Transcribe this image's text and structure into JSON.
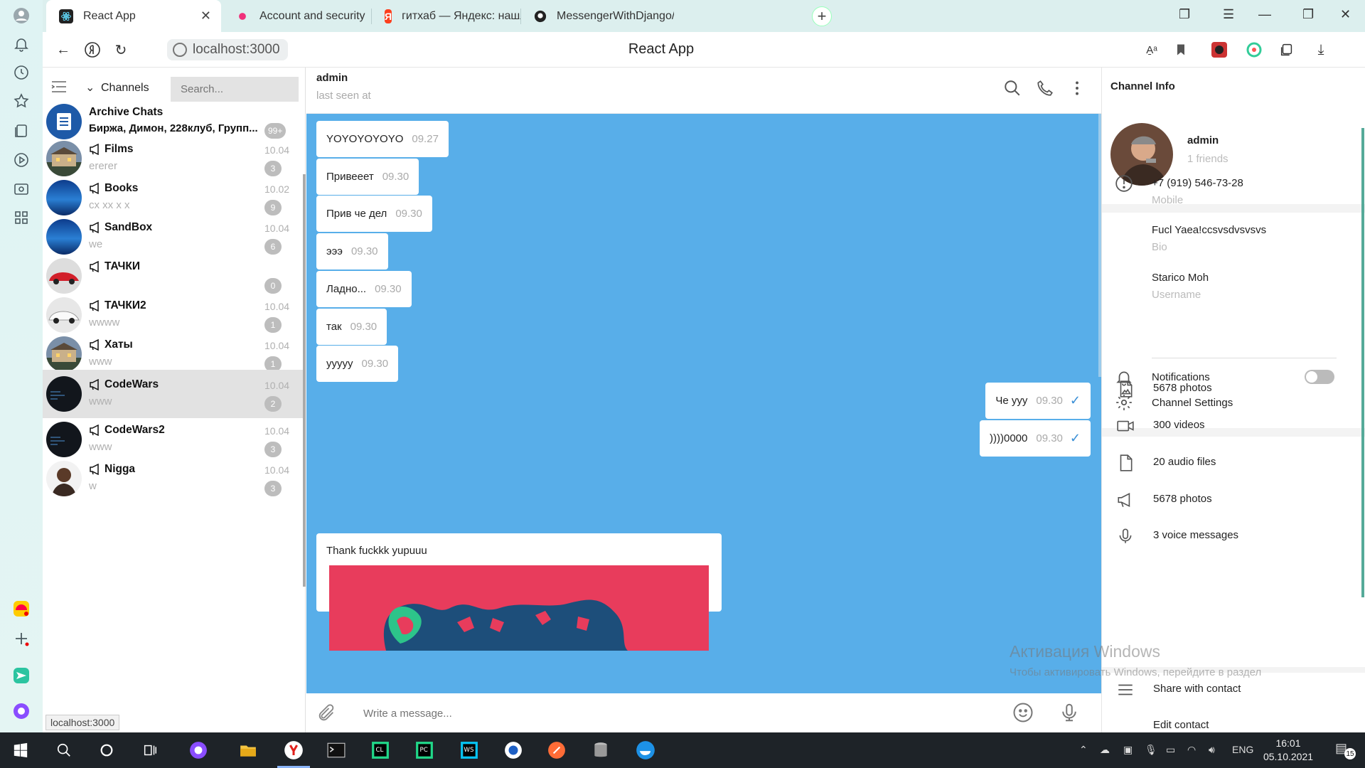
{
  "browser": {
    "tabs": [
      {
        "title": "React App",
        "active": true
      },
      {
        "title": "Account and security",
        "active": false
      },
      {
        "title": "гитхаб — Яндекс: нашлос",
        "active": false
      },
      {
        "title": "MessengerWithDjango/Co",
        "active": false
      }
    ],
    "url": "localhost:3000",
    "page_title": "React App",
    "status_url": "localhost:3000"
  },
  "list": {
    "section_label": "Channels",
    "search_placeholder": "Search...",
    "chats": [
      {
        "name": "Archive Chats",
        "preview": "Биржа, Димон, 228клуб, Групп...",
        "time": "",
        "badge": "99+",
        "channel": false,
        "avatar": "archive",
        "preview_dark": true
      },
      {
        "name": "Films",
        "preview": "ererer",
        "time": "10.04",
        "badge": "3",
        "channel": true,
        "avatar": "house"
      },
      {
        "name": "Books",
        "preview": "cx xx x x",
        "time": "10.02",
        "badge": "9",
        "channel": true,
        "avatar": "blue"
      },
      {
        "name": "SandBox",
        "preview": "we",
        "time": "10.04",
        "badge": "6",
        "channel": true,
        "avatar": "blue"
      },
      {
        "name": "ТАЧКИ",
        "preview": "",
        "time": "",
        "badge": "0",
        "channel": true,
        "avatar": "redcar"
      },
      {
        "name": "ТАЧКИ2",
        "preview": "wwww",
        "time": "10.04",
        "badge": "1",
        "channel": true,
        "avatar": "whitecar"
      },
      {
        "name": "Хаты",
        "preview": "www",
        "time": "10.04",
        "badge": "1",
        "channel": true,
        "avatar": "house"
      },
      {
        "name": "CodeWars",
        "preview": "www",
        "time": "10.04",
        "badge": "2",
        "channel": true,
        "avatar": "dark",
        "selected": true
      },
      {
        "name": "CodeWars2",
        "preview": "www",
        "time": "10.04",
        "badge": "3",
        "channel": true,
        "avatar": "dark"
      },
      {
        "name": "Nigga",
        "preview": "w",
        "time": "10.04",
        "badge": "3",
        "channel": true,
        "avatar": "person"
      }
    ]
  },
  "conversation": {
    "name": "admin",
    "status": "last seen at",
    "messages": [
      {
        "text": "YOYOYOYOYO",
        "time": "09.27",
        "out": false
      },
      {
        "text": "Привееет",
        "time": "09.30",
        "out": false
      },
      {
        "text": "Прив че дел",
        "time": "09.30",
        "out": false
      },
      {
        "text": "эээ",
        "time": "09.30",
        "out": false
      },
      {
        "text": "Ладно...",
        "time": "09.30",
        "out": false
      },
      {
        "text": "так",
        "time": "09.30",
        "out": false
      },
      {
        "text": "yyyyy",
        "time": "09.30",
        "out": false
      },
      {
        "text": "Че ууу",
        "time": "09.30",
        "out": true,
        "read": true
      },
      {
        "text": "))))0000",
        "time": "09.30",
        "out": true,
        "read": true
      }
    ],
    "image_message": {
      "caption": "Thank fuckkk yupuuu"
    },
    "composer_placeholder": "Write a message..."
  },
  "info": {
    "title": "Channel Info",
    "name": "admin",
    "friends": "1 friends",
    "phone": "+7 (919) 546-73-28",
    "phone_label": "Mobile",
    "bio": "Fucl Yaea!ccsvsdvsvsvs",
    "bio_label": "Bio",
    "username": "Starico Moh",
    "username_label": "Username",
    "notifications": "Notifications",
    "notifications_on": false,
    "settings": "Channel Settings",
    "media": [
      {
        "label": "5678 photos",
        "icon": "photo-icon"
      },
      {
        "label": "300 videos",
        "icon": "video-icon"
      },
      {
        "label": "20 audio files",
        "icon": "file-icon"
      },
      {
        "label": "5678 photos",
        "icon": "megaphone-icon"
      },
      {
        "label": "3 voice messages",
        "icon": "mic-icon"
      }
    ],
    "share": "Share with contact",
    "edit": "Edit contact"
  },
  "watermark": {
    "line1": "Активация Windows",
    "line2": "Чтобы активировать Windows, перейдите в раздел"
  },
  "taskbar": {
    "lang": "ENG",
    "time": "16:01",
    "date": "05.10.2021",
    "notif_count": "15"
  },
  "colors": {
    "chat_background": "#58aee9",
    "tab_bar": "#dcefee",
    "check_blue": "#3a8fd6"
  }
}
